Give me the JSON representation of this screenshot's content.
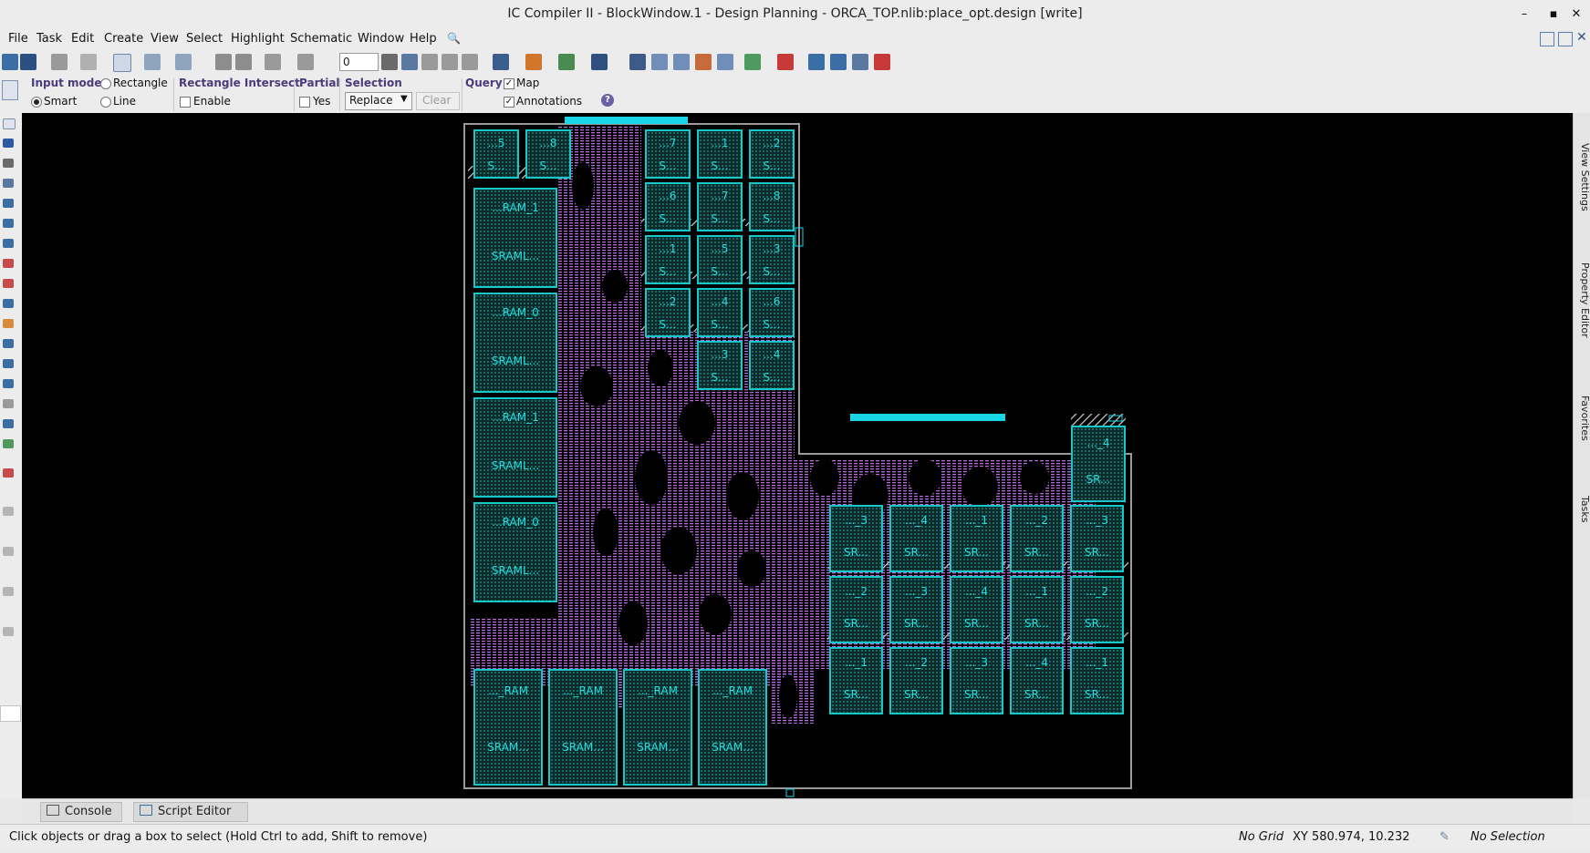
{
  "window": {
    "title": "IC Compiler II - BlockWindow.1 - Design Planning - ORCA_TOP.nlib:place_opt.design [write]",
    "buttons": [
      "–",
      "▪",
      "✕"
    ]
  },
  "menu": [
    "File",
    "Task",
    "Edit",
    "Create",
    "View",
    "Select",
    "Highlight",
    "Schematic",
    "Window",
    "Help"
  ],
  "toolbar": {
    "spin_value": "0"
  },
  "options": {
    "input_mode_label": "Input mode",
    "rectangle": "Rectangle",
    "smart": "Smart",
    "line": "Line",
    "rect_intersect_label": "Rectangle Intersect",
    "enable": "Enable",
    "partial_label": "Partial",
    "yes": "Yes",
    "selection_label": "Selection",
    "selection_value": "Replace",
    "clear": "Clear",
    "query_label": "Query",
    "map": "Map",
    "annotations": "Annotations",
    "input_mode_selected": "Smart",
    "map_checked": true,
    "annotations_checked": true,
    "enable_checked": false,
    "yes_checked": false
  },
  "right_tabs": [
    "View Settings",
    "Property Editor",
    "Favorites",
    "Tasks"
  ],
  "console_tabs": [
    "Console",
    "Script Editor"
  ],
  "status": {
    "message": "Click objects or drag a box to select (Hold Ctrl to add, Shift to remove)",
    "grid": "No Grid",
    "xy": "XY 580.974, 10.232",
    "selection": "No Selection"
  },
  "layout_macros": {
    "top_small_left": [
      [
        "...5",
        "S..."
      ],
      [
        "...8",
        "S..."
      ]
    ],
    "top_grid": [
      [
        [
          "...7",
          "S..."
        ],
        [
          "...1",
          "S..."
        ],
        [
          "...2",
          "S..."
        ]
      ],
      [
        [
          "...6",
          "S..."
        ],
        [
          "...7",
          "S..."
        ],
        [
          "...8",
          "S..."
        ]
      ],
      [
        [
          "...1",
          "S..."
        ],
        [
          "...5",
          "S..."
        ],
        [
          "...3",
          "S..."
        ]
      ],
      [
        [
          "...2",
          "S..."
        ],
        [
          "...4",
          "S..."
        ],
        [
          "...6",
          "S..."
        ]
      ],
      [
        [
          "",
          ""
        ],
        [
          "...3",
          "S..."
        ],
        [
          "...4",
          "S..."
        ]
      ]
    ],
    "left_column": [
      [
        "...RAM_1",
        "SRAML..."
      ],
      [
        "...RAM_0",
        "SRAML..."
      ],
      [
        "...RAM_1",
        "SRAML..."
      ],
      [
        "...RAM_0",
        "SRAML..."
      ]
    ],
    "bottom_left": [
      [
        "..._RAM",
        "SRAM..."
      ],
      [
        "..._RAM",
        "SRAM..."
      ],
      [
        "..._RAM",
        "SRAM..."
      ],
      [
        "..._RAM",
        "SRAM..."
      ]
    ],
    "right_single": [
      "..._4",
      "SR..."
    ],
    "right_grid": [
      [
        [
          "..._3",
          "SR..."
        ],
        [
          "..._4",
          "SR..."
        ],
        [
          "..._1",
          "SR..."
        ],
        [
          "..._2",
          "SR..."
        ],
        [
          "..._3",
          "SR..."
        ]
      ],
      [
        [
          "..._2",
          "SR..."
        ],
        [
          "..._3",
          "SR..."
        ],
        [
          "..._4",
          "SR..."
        ],
        [
          "..._1",
          "SR..."
        ],
        [
          "..._2",
          "SR..."
        ]
      ],
      [
        [
          "..._1",
          "SR..."
        ],
        [
          "..._2",
          "SR..."
        ],
        [
          "..._3",
          "SR..."
        ],
        [
          "..._4",
          "SR..."
        ],
        [
          "..._1",
          "SR..."
        ]
      ]
    ]
  }
}
